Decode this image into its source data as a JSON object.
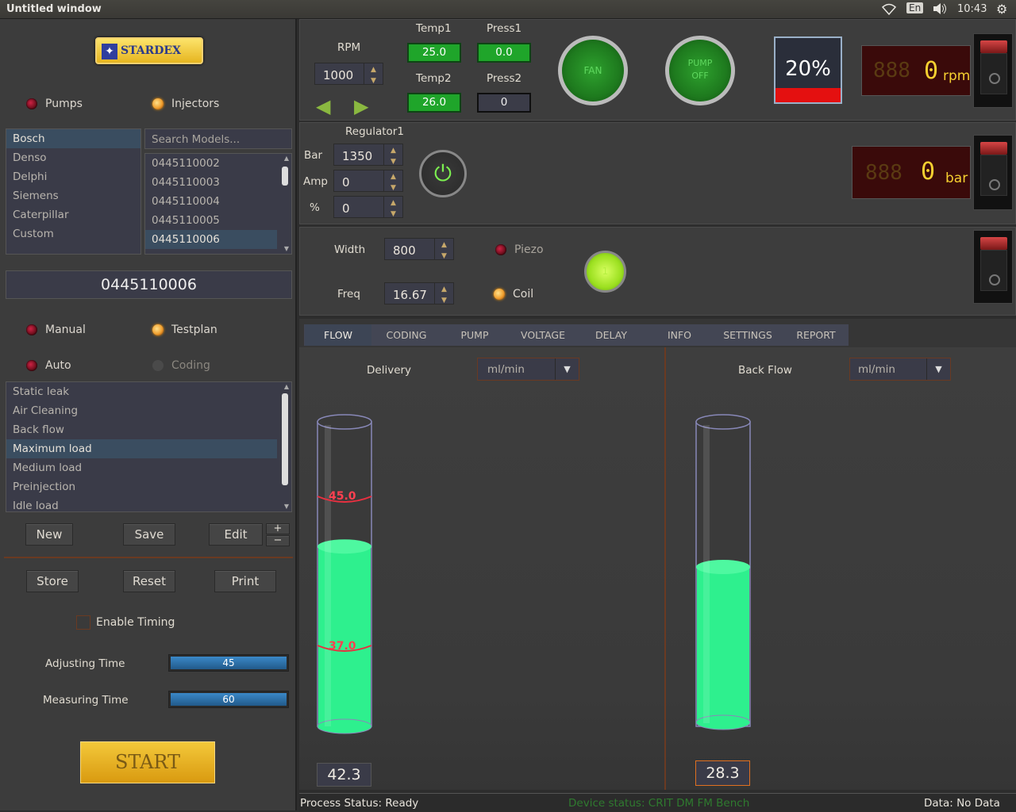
{
  "window": {
    "title": "Untitled window",
    "lang": "En",
    "time": "10:43"
  },
  "logo": "STARDEX",
  "mode": {
    "pumps": "Pumps",
    "injectors": "Injectors"
  },
  "manufacturers": [
    "Bosch",
    "Denso",
    "Delphi",
    "Siemens",
    "Caterpillar",
    "Custom"
  ],
  "search_placeholder": "Search Models...",
  "models": [
    "0445110002",
    "0445110003",
    "0445110004",
    "0445110005",
    "0445110006"
  ],
  "selected_model": "0445110006",
  "test_mode": {
    "manual": "Manual",
    "testplan": "Testplan",
    "auto": "Auto",
    "coding": "Coding"
  },
  "tests": [
    "Static leak",
    "Air Cleaning",
    "Back flow",
    "Maximum load",
    "Medium load",
    "Preinjection",
    "Idle load"
  ],
  "buttons": {
    "new": "New",
    "save": "Save",
    "edit": "Edit",
    "plus": "+",
    "minus": "−",
    "store": "Store",
    "reset": "Reset",
    "print": "Print",
    "start": "START"
  },
  "timing": {
    "enable": "Enable Timing",
    "adjusting_label": "Adjusting Time",
    "adjusting_value": "45",
    "measuring_label": "Measuring Time",
    "measuring_value": "60"
  },
  "rpm": {
    "label": "RPM",
    "value": "1000"
  },
  "temp1": {
    "label": "Temp1",
    "value": "25.0"
  },
  "press1": {
    "label": "Press1",
    "value": "0.0"
  },
  "temp2": {
    "label": "Temp2",
    "value": "26.0"
  },
  "press2": {
    "label": "Press2",
    "value": "0"
  },
  "fan": "FAN",
  "pump_off": "PUMP OFF",
  "percent": "20%",
  "rpm_display": {
    "value": "0",
    "unit": "rpm"
  },
  "regulator": {
    "title": "Regulator1",
    "bar_label": "Bar",
    "bar_value": "1350",
    "amp_label": "Amp",
    "amp_value": "0",
    "pct_label": "%",
    "pct_value": "0"
  },
  "bar_display": {
    "value": "0",
    "unit": "bar"
  },
  "injector": {
    "width_label": "Width",
    "width_value": "800",
    "freq_label": "Freq",
    "freq_value": "16.67",
    "piezo": "Piezo",
    "coil": "Coil",
    "indicator": "1"
  },
  "tabs": [
    "FLOW",
    "CODING",
    "PUMP",
    "VOLTAGE",
    "DELAY",
    "INFO",
    "SETTINGS",
    "REPORT"
  ],
  "delivery": {
    "label": "Delivery",
    "unit": "ml/min",
    "max": "45.0",
    "min": "37.0",
    "value": "42.3",
    "fill": 0.63
  },
  "backflow": {
    "label": "Back Flow",
    "unit": "ml/min",
    "value": "28.3",
    "fill": 0.56
  },
  "status": {
    "process": "Process Status: Ready",
    "device": "Device status: CRIT DM FM Bench",
    "data": "Data: No Data"
  },
  "colors": {
    "accent_orange": "#f0a030",
    "liquid": "#2ef08e",
    "start": "#e8b020",
    "lcd_green": "#1fa52a"
  }
}
